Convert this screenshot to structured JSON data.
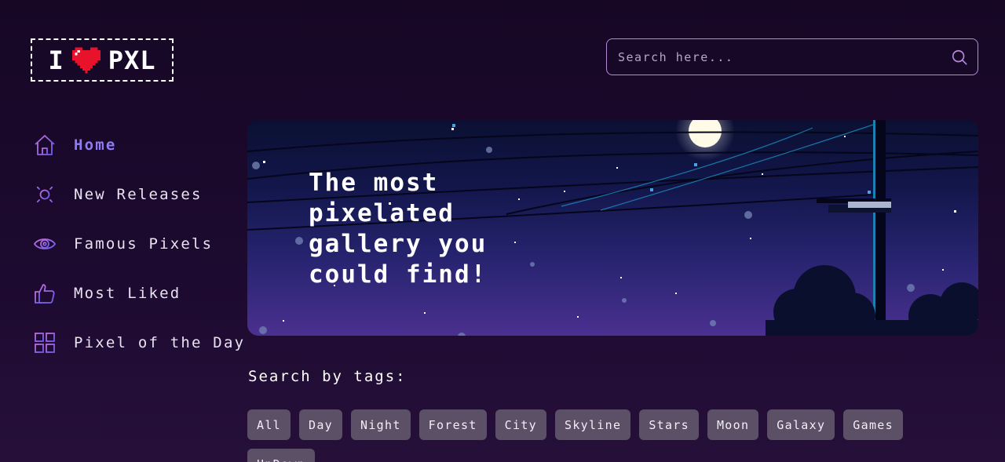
{
  "logo": {
    "text_left": "I",
    "text_right": "PXL",
    "heart_icon": "pixel-heart-icon"
  },
  "search": {
    "placeholder": "Search here...",
    "icon": "search-icon"
  },
  "sidebar": {
    "items": [
      {
        "label": "Home",
        "icon": "home-icon",
        "active": true
      },
      {
        "label": "New Releases",
        "icon": "sun-icon",
        "active": false
      },
      {
        "label": "Famous Pixels",
        "icon": "eye-icon",
        "active": false
      },
      {
        "label": "Most Liked",
        "icon": "thumbs-up-icon",
        "active": false
      },
      {
        "label": "Pixel of the Day",
        "icon": "grid-icon",
        "active": false
      }
    ]
  },
  "hero": {
    "line1": "The most",
    "line2": "pixelated",
    "line3": "gallery you",
    "line4": "could find!"
  },
  "tags_section": {
    "title": "Search by tags:",
    "tags": [
      "All",
      "Day",
      "Night",
      "Forest",
      "City",
      "Skyline",
      "Stars",
      "Moon",
      "Galaxy",
      "Games",
      "UpDown"
    ]
  },
  "colors": {
    "background": "#1a0829",
    "accent": "#8e7cf4",
    "icon_gradient_start": "#b46fe0",
    "icon_gradient_end": "#6f5cf0",
    "search_border": "#b58bd8",
    "tag_bg": "#5b5066"
  }
}
